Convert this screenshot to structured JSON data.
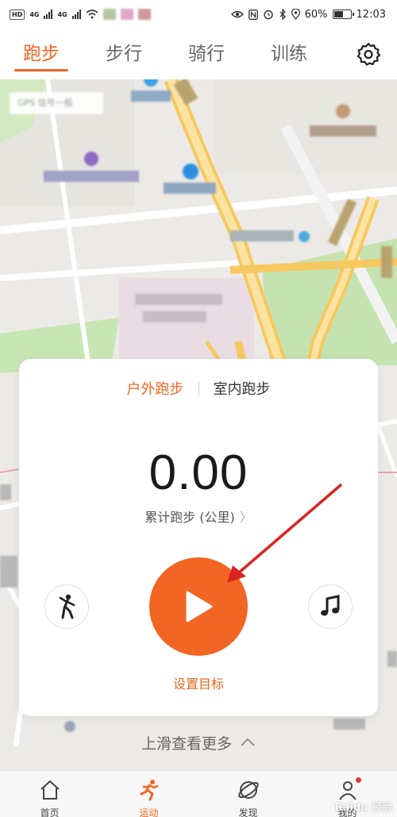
{
  "status_bar": {
    "network_badge": "HD",
    "signal_label_1": "4G",
    "signal_label_2": "4G",
    "battery_percent": "60%",
    "battery_level": 0.6,
    "time": "12:03"
  },
  "tabs": [
    {
      "label": "跑步",
      "active": true
    },
    {
      "label": "步行",
      "active": false
    },
    {
      "label": "骑行",
      "active": false
    },
    {
      "label": "训练",
      "active": false
    }
  ],
  "map": {
    "gps_chip": "GPS 信号一般"
  },
  "card": {
    "modes": [
      {
        "label": "户外跑步",
        "active": true
      },
      {
        "label": "室内跑步",
        "active": false
      }
    ],
    "distance_value": "0.00",
    "distance_label": "累计跑步 (公里)",
    "goal_label": "设置目标"
  },
  "swipe_hint": "上滑查看更多",
  "bottom_nav": [
    {
      "label": "首页",
      "icon": "home-icon",
      "active": false
    },
    {
      "label": "运动",
      "icon": "running-icon",
      "active": true
    },
    {
      "label": "发现",
      "icon": "discover-icon",
      "active": false
    },
    {
      "label": "我的",
      "icon": "profile-icon",
      "active": false
    }
  ],
  "watermark": "Baidu 经验",
  "colors": {
    "accent": "#f26522",
    "map_park": "#c8e6b4",
    "map_road": "#f7d77a",
    "arrow": "#d92424"
  }
}
